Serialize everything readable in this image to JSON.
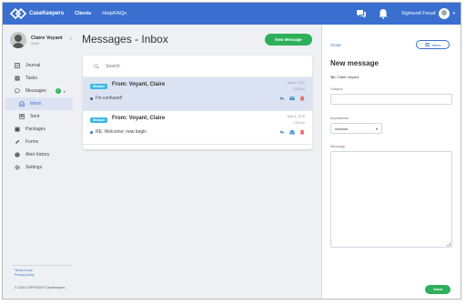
{
  "app": {
    "name": "CaseKeepers"
  },
  "topnav": {
    "items": [
      "Clients",
      "Help/FAQs"
    ],
    "user_name": "Sigmund Freud"
  },
  "sidebar": {
    "profile": {
      "name": "Claire Voyant",
      "role": "Client"
    },
    "items": [
      {
        "label": "Journal",
        "icon": "journal-icon"
      },
      {
        "label": "Tasks",
        "icon": "tasks-icon"
      },
      {
        "label": "Messages",
        "icon": "chat-icon",
        "badge": "1"
      },
      {
        "label": "Inbox",
        "icon": "inbox-icon"
      },
      {
        "label": "Sent",
        "icon": "sent-icon"
      },
      {
        "label": "Packages",
        "icon": "packages-icon"
      },
      {
        "label": "Forms",
        "icon": "forms-icon"
      },
      {
        "label": "Alert history",
        "icon": "alert-icon"
      },
      {
        "label": "Settings",
        "icon": "gear-icon"
      }
    ],
    "footer_links": [
      "Terms of use",
      "Privacy policy"
    ],
    "copyright": "© 2019 COPYRIGHT CaseKeepers"
  },
  "main": {
    "title": "Messages - Inbox",
    "new_message_label": "New Message",
    "search_placeholder": "Search",
    "messages": [
      {
        "priority": "Medium",
        "from": "From: Voyant, Claire",
        "date": "May 5, 2019",
        "time": "3:36 pm",
        "subject": "I'm confused!"
      },
      {
        "priority": "Medium",
        "from": "From: Voyant, Claire",
        "date": "May 5, 2019",
        "time": "3:36 pm",
        "subject": "RE: Welcome; now begin"
      }
    ]
  },
  "compose": {
    "close_label": "Close",
    "items_label": "Items",
    "title": "New message",
    "to_label": "To:",
    "to_value": "Claire Voyant",
    "subject_label": "Subject",
    "importance_label": "Importance",
    "importance_value": "medium",
    "message_label": "Message",
    "send_label": "Send"
  },
  "colors": {
    "primary": "#3a6fd0",
    "success": "#2eb05a",
    "priority": "#3db6e6",
    "selected_row": "#dbe3f3"
  }
}
